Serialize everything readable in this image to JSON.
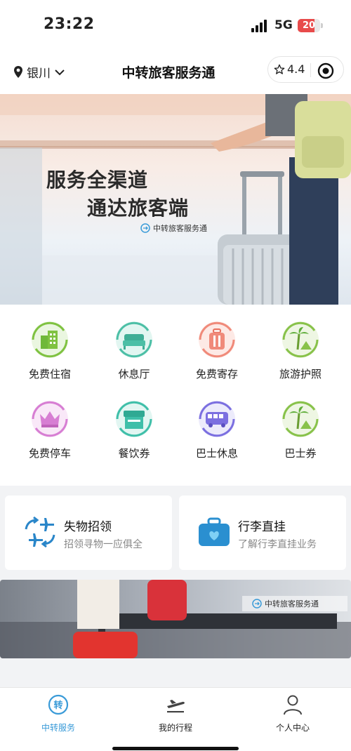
{
  "status_bar": {
    "time": "23:22",
    "network": "5G",
    "battery": "20",
    "battery_level": 0.2
  },
  "header": {
    "city": "银川",
    "title": "中转旅客服务通",
    "rating": "4.4"
  },
  "banner": {
    "line1": "服务全渠道",
    "line2": "通达旅客端",
    "brand": "中转旅客服务通"
  },
  "services": [
    {
      "label": "免费住宿",
      "icon": "building-icon",
      "color": "#7fc241"
    },
    {
      "label": "休息厅",
      "icon": "bed-icon",
      "color": "#4cbfa6"
    },
    {
      "label": "免费寄存",
      "icon": "luggage-icon",
      "color": "#f08a7a"
    },
    {
      "label": "旅游护照",
      "icon": "palm-tree-icon",
      "color": "#88c24a"
    },
    {
      "label": "免费停车",
      "icon": "crown-icon",
      "color": "#d77ed3"
    },
    {
      "label": "餐饮券",
      "icon": "shop-icon",
      "color": "#3fbfa9"
    },
    {
      "label": "巴士休息",
      "icon": "bus-icon",
      "color": "#7b6fe0"
    },
    {
      "label": "巴士券",
      "icon": "palm-tree-icon",
      "color": "#88c24a"
    }
  ],
  "cards": {
    "lost_found": {
      "title": "失物招领",
      "subtitle": "招领寻物一应俱全"
    },
    "baggage": {
      "title": "行李直挂",
      "subtitle": "了解行李直挂业务"
    }
  },
  "banner2": {
    "brand": "中转旅客服务通"
  },
  "tabs": [
    {
      "label": "中转服务",
      "active": true
    },
    {
      "label": "我的行程",
      "active": false
    },
    {
      "label": "个人中心",
      "active": false
    }
  ],
  "colors": {
    "accent": "#3a9bd8",
    "battery_low": "#e84b4b"
  }
}
